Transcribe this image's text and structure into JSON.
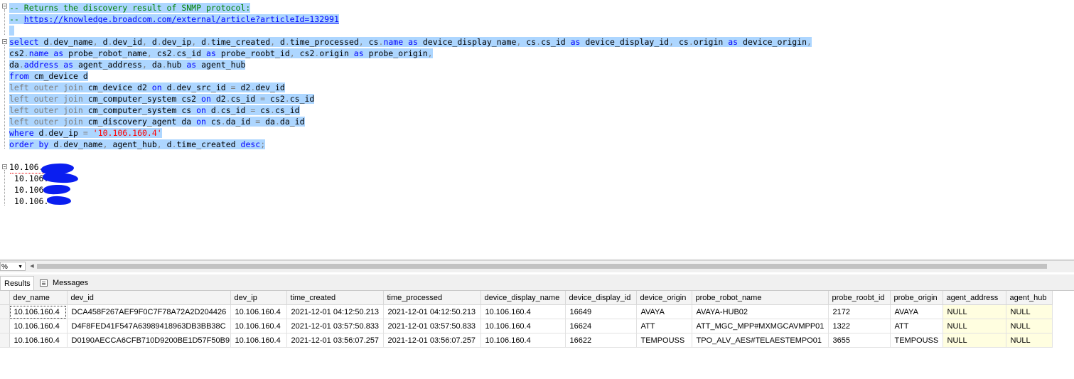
{
  "editor": {
    "lines": [
      {
        "segments": [
          {
            "t": "-- Returns the discovery result of SNMP protocol:",
            "c": "c-com"
          }
        ]
      },
      {
        "segments": [
          {
            "t": "-- ",
            "c": "c-com"
          },
          {
            "t": "https://knowledge.broadcom.com/external/article?articleId=132991",
            "c": "c-link"
          }
        ]
      },
      {
        "segments": [
          {
            "t": " ",
            "c": ""
          }
        ]
      },
      {
        "segments": [
          {
            "t": "select",
            "c": "c-kw"
          },
          {
            "t": " d",
            "c": ""
          },
          {
            "t": ".",
            "c": "c-gray"
          },
          {
            "t": "dev_name",
            "c": ""
          },
          {
            "t": ",",
            "c": "c-gray"
          },
          {
            "t": " d",
            "c": ""
          },
          {
            "t": ".",
            "c": "c-gray"
          },
          {
            "t": "dev_id",
            "c": ""
          },
          {
            "t": ",",
            "c": "c-gray"
          },
          {
            "t": " d",
            "c": ""
          },
          {
            "t": ".",
            "c": "c-gray"
          },
          {
            "t": "dev_ip",
            "c": ""
          },
          {
            "t": ",",
            "c": "c-gray"
          },
          {
            "t": " d",
            "c": ""
          },
          {
            "t": ".",
            "c": "c-gray"
          },
          {
            "t": "time_created",
            "c": ""
          },
          {
            "t": ",",
            "c": "c-gray"
          },
          {
            "t": " d",
            "c": ""
          },
          {
            "t": ".",
            "c": "c-gray"
          },
          {
            "t": "time_processed",
            "c": ""
          },
          {
            "t": ",",
            "c": "c-gray"
          },
          {
            "t": " cs",
            "c": ""
          },
          {
            "t": ".",
            "c": "c-gray"
          },
          {
            "t": "name",
            "c": "c-kw"
          },
          {
            "t": " as",
            "c": "c-kw"
          },
          {
            "t": " device_display_name",
            "c": ""
          },
          {
            "t": ",",
            "c": "c-gray"
          },
          {
            "t": " cs",
            "c": ""
          },
          {
            "t": ".",
            "c": "c-gray"
          },
          {
            "t": "cs_id",
            "c": ""
          },
          {
            "t": " as",
            "c": "c-kw"
          },
          {
            "t": " device_display_id",
            "c": ""
          },
          {
            "t": ",",
            "c": "c-gray"
          },
          {
            "t": " cs",
            "c": ""
          },
          {
            "t": ".",
            "c": "c-gray"
          },
          {
            "t": "origin",
            "c": ""
          },
          {
            "t": " as",
            "c": "c-kw"
          },
          {
            "t": " device_origin",
            "c": ""
          },
          {
            "t": ",",
            "c": "c-gray"
          }
        ]
      },
      {
        "segments": [
          {
            "t": "cs2",
            "c": ""
          },
          {
            "t": ".",
            "c": "c-gray"
          },
          {
            "t": "name",
            "c": "c-kw"
          },
          {
            "t": " as",
            "c": "c-kw"
          },
          {
            "t": " probe_robot_name",
            "c": ""
          },
          {
            "t": ",",
            "c": "c-gray"
          },
          {
            "t": " cs2",
            "c": ""
          },
          {
            "t": ".",
            "c": "c-gray"
          },
          {
            "t": "cs_id",
            "c": ""
          },
          {
            "t": " as",
            "c": "c-kw"
          },
          {
            "t": " probe_roobt_id",
            "c": ""
          },
          {
            "t": ",",
            "c": "c-gray"
          },
          {
            "t": " cs2",
            "c": ""
          },
          {
            "t": ".",
            "c": "c-gray"
          },
          {
            "t": "origin",
            "c": ""
          },
          {
            "t": " as",
            "c": "c-kw"
          },
          {
            "t": " probe_origin",
            "c": ""
          },
          {
            "t": ",",
            "c": "c-gray"
          }
        ]
      },
      {
        "segments": [
          {
            "t": "da",
            "c": ""
          },
          {
            "t": ".",
            "c": "c-gray"
          },
          {
            "t": "address",
            "c": "c-kw"
          },
          {
            "t": " as",
            "c": "c-kw"
          },
          {
            "t": " agent_address",
            "c": ""
          },
          {
            "t": ",",
            "c": "c-gray"
          },
          {
            "t": " da",
            "c": ""
          },
          {
            "t": ".",
            "c": "c-gray"
          },
          {
            "t": "hub",
            "c": ""
          },
          {
            "t": " as",
            "c": "c-kw"
          },
          {
            "t": " agent_hub",
            "c": ""
          }
        ]
      },
      {
        "segments": [
          {
            "t": "from",
            "c": "c-kw"
          },
          {
            "t": " cm_device d",
            "c": ""
          }
        ]
      },
      {
        "segments": [
          {
            "t": "left outer join",
            "c": "c-gray"
          },
          {
            "t": " cm_device d2 ",
            "c": ""
          },
          {
            "t": "on",
            "c": "c-kw"
          },
          {
            "t": " d",
            "c": ""
          },
          {
            "t": ".",
            "c": "c-gray"
          },
          {
            "t": "dev_src_id ",
            "c": ""
          },
          {
            "t": "=",
            "c": "c-gray"
          },
          {
            "t": " d2",
            "c": ""
          },
          {
            "t": ".",
            "c": "c-gray"
          },
          {
            "t": "dev_id",
            "c": ""
          }
        ]
      },
      {
        "segments": [
          {
            "t": "left outer join",
            "c": "c-gray"
          },
          {
            "t": " cm_computer_system cs2 ",
            "c": ""
          },
          {
            "t": "on",
            "c": "c-kw"
          },
          {
            "t": " d2",
            "c": ""
          },
          {
            "t": ".",
            "c": "c-gray"
          },
          {
            "t": "cs_id ",
            "c": ""
          },
          {
            "t": "=",
            "c": "c-gray"
          },
          {
            "t": " cs2",
            "c": ""
          },
          {
            "t": ".",
            "c": "c-gray"
          },
          {
            "t": "cs_id",
            "c": ""
          }
        ]
      },
      {
        "segments": [
          {
            "t": "left outer join",
            "c": "c-gray"
          },
          {
            "t": " cm_computer_system cs ",
            "c": ""
          },
          {
            "t": "on",
            "c": "c-kw"
          },
          {
            "t": " d",
            "c": ""
          },
          {
            "t": ".",
            "c": "c-gray"
          },
          {
            "t": "cs_id ",
            "c": ""
          },
          {
            "t": "=",
            "c": "c-gray"
          },
          {
            "t": " cs",
            "c": ""
          },
          {
            "t": ".",
            "c": "c-gray"
          },
          {
            "t": "cs_id",
            "c": ""
          }
        ]
      },
      {
        "segments": [
          {
            "t": "left outer join",
            "c": "c-gray"
          },
          {
            "t": " cm_discovery_agent da ",
            "c": ""
          },
          {
            "t": "on",
            "c": "c-kw"
          },
          {
            "t": " cs",
            "c": ""
          },
          {
            "t": ".",
            "c": "c-gray"
          },
          {
            "t": "da_id ",
            "c": ""
          },
          {
            "t": "=",
            "c": "c-gray"
          },
          {
            "t": " da",
            "c": ""
          },
          {
            "t": ".",
            "c": "c-gray"
          },
          {
            "t": "da_id",
            "c": ""
          }
        ]
      },
      {
        "segments": [
          {
            "t": "where",
            "c": "c-kw"
          },
          {
            "t": " d",
            "c": ""
          },
          {
            "t": ".",
            "c": "c-gray"
          },
          {
            "t": "dev_ip ",
            "c": ""
          },
          {
            "t": "=",
            "c": "c-gray"
          },
          {
            "t": " ",
            "c": ""
          },
          {
            "t": "'10.106.160.4'",
            "c": "c-str"
          }
        ]
      },
      {
        "segments": [
          {
            "t": "order by",
            "c": "c-kw"
          },
          {
            "t": " d",
            "c": ""
          },
          {
            "t": ".",
            "c": "c-gray"
          },
          {
            "t": "dev_name",
            "c": ""
          },
          {
            "t": ",",
            "c": "c-gray"
          },
          {
            "t": " agent_hub",
            "c": ""
          },
          {
            "t": ",",
            "c": "c-gray"
          },
          {
            "t": " d",
            "c": ""
          },
          {
            "t": ".",
            "c": "c-gray"
          },
          {
            "t": "time_created ",
            "c": ""
          },
          {
            "t": "desc",
            "c": "c-kw"
          },
          {
            "t": ";",
            "c": "c-gray"
          }
        ]
      },
      {
        "segments": [
          {
            "t": "",
            "c": ""
          }
        ]
      },
      {
        "segments": [
          {
            "t": "10.106.",
            "c": ""
          }
        ]
      },
      {
        "segments": [
          {
            "t": " 10.106.",
            "c": ""
          }
        ]
      },
      {
        "segments": [
          {
            "t": " 10.106.",
            "c": ""
          }
        ]
      },
      {
        "segments": [
          {
            "t": " 10.106.",
            "c": ""
          }
        ]
      }
    ]
  },
  "zoom": {
    "value": "%"
  },
  "tabs": {
    "results": "Results",
    "messages": "Messages"
  },
  "grid": {
    "columns": [
      "dev_name",
      "dev_id",
      "dev_ip",
      "time_created",
      "time_processed",
      "device_display_name",
      "device_display_id",
      "device_origin",
      "probe_robot_name",
      "probe_roobt_id",
      "probe_origin",
      "agent_address",
      "agent_hub"
    ],
    "rows": [
      [
        "10.106.160.4",
        "DCA458F267AEF9F0C7F78A72A2D204426",
        "10.106.160.4",
        "2021-12-01 04:12:50.213",
        "2021-12-01 04:12:50.213",
        "10.106.160.4",
        "16649",
        "AVAYA",
        "AVAYA-HUB02",
        "2172",
        "AVAYA",
        "NULL",
        "NULL"
      ],
      [
        "10.106.160.4",
        "D4F8FED41F547A63989418963DB3BB38C",
        "10.106.160.4",
        "2021-12-01 03:57:50.833",
        "2021-12-01 03:57:50.833",
        "10.106.160.4",
        "16624",
        "ATT",
        "ATT_MGC_MPP#MXMGCAVMPP01",
        "1322",
        "ATT",
        "NULL",
        "NULL"
      ],
      [
        "10.106.160.4",
        "D0190AECCA6CFB710D9200BE1D57F50B9",
        "10.106.160.4",
        "2021-12-01 03:56:07.257",
        "2021-12-01 03:56:07.257",
        "10.106.160.4",
        "16622",
        "TEMPOUSS",
        "TPO_ALV_AES#TELAESTEMPO01",
        "3655",
        "TEMPOUSS",
        "NULL",
        "NULL"
      ]
    ]
  }
}
